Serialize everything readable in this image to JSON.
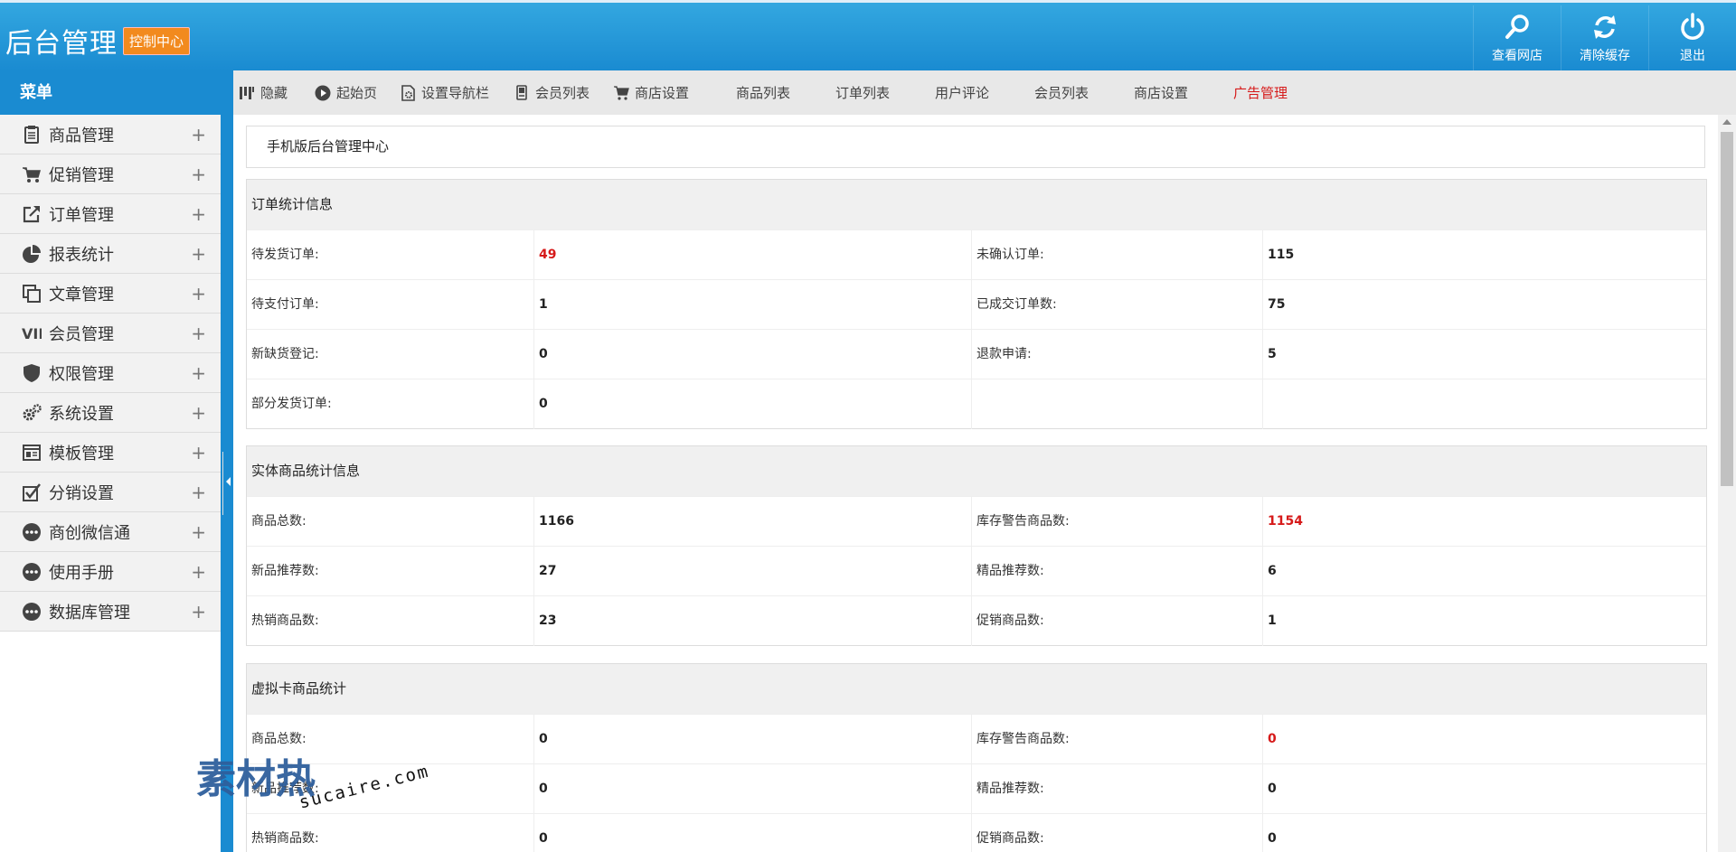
{
  "header": {
    "logo_text": "后台管理",
    "logo_badge": "控制中心",
    "actions": [
      {
        "label": "查看网店",
        "icon": "search-icon"
      },
      {
        "label": "清除缓存",
        "icon": "refresh-icon"
      },
      {
        "label": "退出",
        "icon": "power-icon"
      }
    ]
  },
  "sidebar": {
    "title": "菜单",
    "items": [
      {
        "label": "商品管理",
        "icon": "clipboard-icon"
      },
      {
        "label": "促销管理",
        "icon": "cart-icon"
      },
      {
        "label": "订单管理",
        "icon": "external-link-icon"
      },
      {
        "label": "报表统计",
        "icon": "pie-chart-icon"
      },
      {
        "label": "文章管理",
        "icon": "copy-icon"
      },
      {
        "label": "会员管理",
        "icon": "vip-icon"
      },
      {
        "label": "权限管理",
        "icon": "shield-icon"
      },
      {
        "label": "系统设置",
        "icon": "gears-icon"
      },
      {
        "label": "模板管理",
        "icon": "template-icon"
      },
      {
        "label": "分销设置",
        "icon": "checkbox-icon"
      },
      {
        "label": "商创微信通",
        "icon": "more-icon"
      },
      {
        "label": "使用手册",
        "icon": "more-icon"
      },
      {
        "label": "数据库管理",
        "icon": "more-icon"
      }
    ],
    "plus": "+"
  },
  "toolbar": {
    "items": [
      {
        "label": "隐藏",
        "icon": "columns-icon"
      },
      {
        "label": "起始页",
        "icon": "play-circle-icon"
      },
      {
        "label": "设置导航栏",
        "icon": "settings-page-icon"
      },
      {
        "label": "会员列表",
        "icon": "member-card-icon"
      },
      {
        "label": "商店设置",
        "icon": "shop-cart-icon"
      }
    ],
    "links": [
      "商品列表",
      "订单列表",
      "用户评论",
      "会员列表",
      "商店设置"
    ],
    "ad_link": "广告管理"
  },
  "main": {
    "title": "手机版后台管理中心",
    "order_panel": {
      "title": "订单统计信息",
      "rows": [
        {
          "l1": "待发货订单:",
          "v1": "49",
          "l2": "未确认订单:",
          "v2": "115"
        },
        {
          "l1": "待支付订单:",
          "v1": "1",
          "l2": "已成交订单数:",
          "v2": "75"
        },
        {
          "l1": "新缺货登记:",
          "v1": "0",
          "l2": "退款申请:",
          "v2": "5"
        },
        {
          "l1": "部分发货订单:",
          "v1": "0",
          "l2": "",
          "v2": ""
        }
      ]
    },
    "goods_panel": {
      "title": "实体商品统计信息",
      "rows": [
        {
          "l1": "商品总数:",
          "v1": "1166",
          "l2": "库存警告商品数:",
          "v2": "1154"
        },
        {
          "l1": "新品推荐数:",
          "v1": "27",
          "l2": "精品推荐数:",
          "v2": "6"
        },
        {
          "l1": "热销商品数:",
          "v1": "23",
          "l2": "促销商品数:",
          "v2": "1"
        }
      ]
    },
    "virtual_panel": {
      "title": "虚拟卡商品统计",
      "rows": [
        {
          "l1": "商品总数:",
          "v1": "0",
          "l2": "库存警告商品数:",
          "v2": "0"
        },
        {
          "l1": "新品推荐数:",
          "v1": "0",
          "l2": "精品推荐数:",
          "v2": "0"
        },
        {
          "l1": "热销商品数:",
          "v1": "0",
          "l2": "促销商品数:",
          "v2": "0"
        }
      ]
    }
  },
  "watermark": {
    "text": "素材热",
    "url": "sucaire.com"
  },
  "colors": {
    "header_blue": "#1a8bd1",
    "badge_orange": "#f28a1e",
    "alert_red": "#d61a1a"
  }
}
